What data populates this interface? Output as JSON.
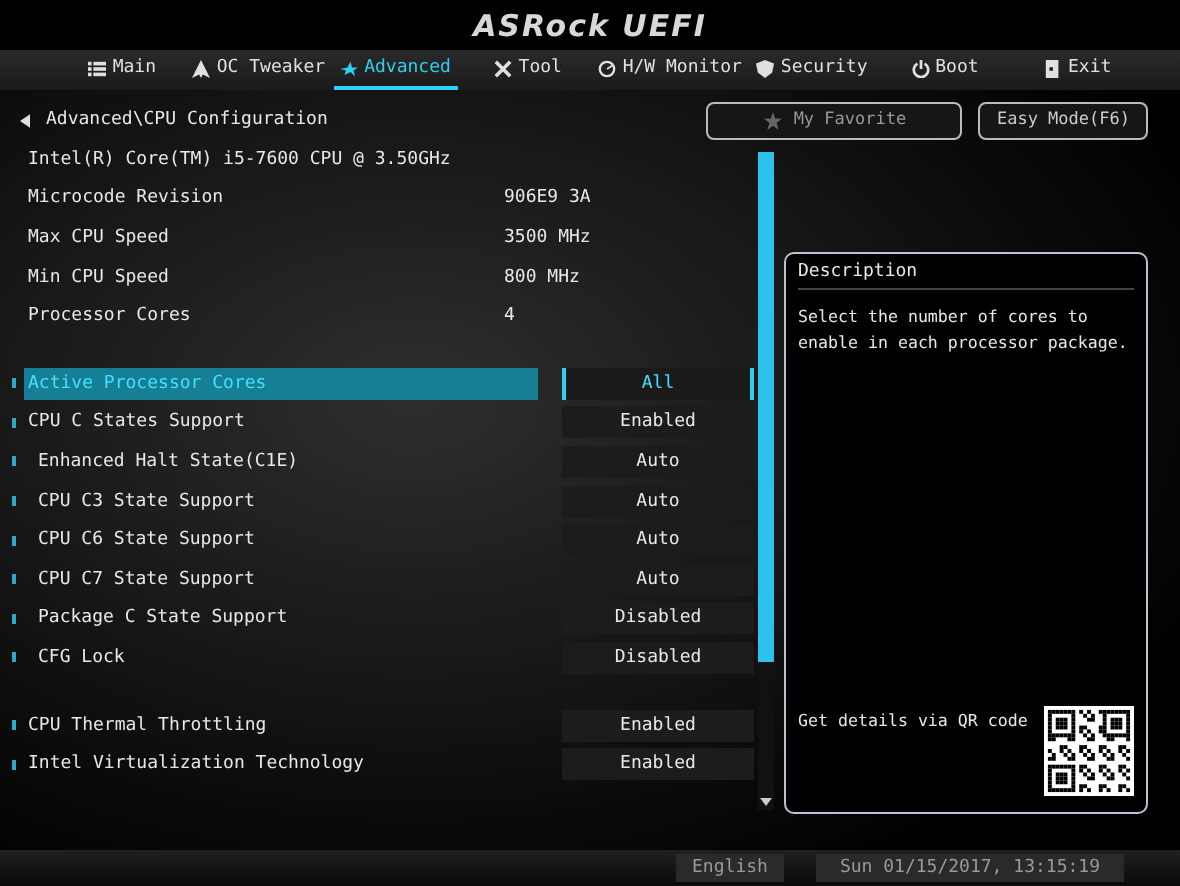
{
  "logo": "ASRock UEFI",
  "tabs": [
    {
      "label": "Main",
      "selected": false
    },
    {
      "label": "OC Tweaker",
      "selected": false
    },
    {
      "label": "Advanced",
      "selected": true
    },
    {
      "label": "Tool",
      "selected": false
    },
    {
      "label": "H/W Monitor",
      "selected": false
    },
    {
      "label": "Security",
      "selected": false
    },
    {
      "label": "Boot",
      "selected": false
    },
    {
      "label": "Exit",
      "selected": false
    }
  ],
  "breadcrumb": "Advanced\\CPU Configuration",
  "favorite_button": "My Favorite",
  "easy_mode_button": "Easy Mode(F6)",
  "cpu_name": "Intel(R) Core(TM) i5-7600 CPU @ 3.50GHz",
  "info_rows": [
    {
      "label": "Microcode Revision",
      "value": "906E9 3A"
    },
    {
      "label": "Max CPU Speed",
      "value": "3500 MHz"
    },
    {
      "label": "Min CPU Speed",
      "value": "800 MHz"
    },
    {
      "label": "Processor Cores",
      "value": "4"
    }
  ],
  "setting_groups": [
    [
      {
        "label": "Active Processor Cores",
        "value": "All",
        "selected": true
      },
      {
        "label": "CPU C States Support",
        "value": "Enabled",
        "selected": false,
        "children": [
          {
            "label": "Enhanced Halt State(C1E)",
            "value": "Auto",
            "selected": false
          },
          {
            "label": "CPU C3 State Support",
            "value": "Auto",
            "selected": false
          },
          {
            "label": "CPU C6 State Support",
            "value": "Auto",
            "selected": false
          },
          {
            "label": "CPU C7 State Support",
            "value": "Auto",
            "selected": false
          },
          {
            "label": "Package C State Support",
            "value": "Disabled",
            "selected": false
          },
          {
            "label": "CFG Lock",
            "value": "Disabled",
            "selected": false
          }
        ]
      }
    ],
    [
      {
        "label": "CPU Thermal Throttling",
        "value": "Enabled",
        "selected": false
      },
      {
        "label": "Intel Virtualization Technology",
        "value": "Enabled",
        "selected": false
      }
    ]
  ],
  "description": {
    "title": "Description",
    "text": "Select the number of cores to enable in each processor package.",
    "qr_label": "Get details via QR code"
  },
  "status_bar": {
    "language": "English",
    "datetime": "Sun 01/15/2017, 13:15:19"
  }
}
